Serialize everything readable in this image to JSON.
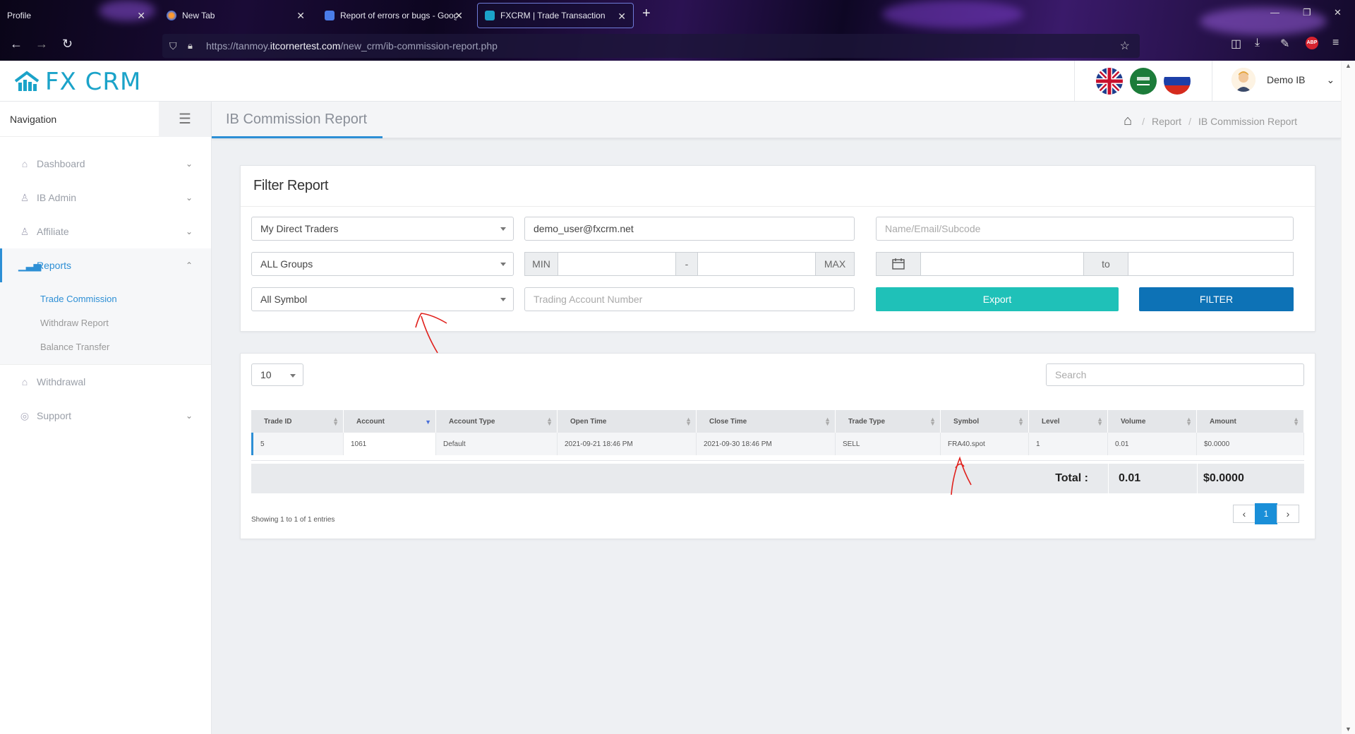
{
  "browser": {
    "tabs": [
      {
        "label": "Profile"
      },
      {
        "label": "New Tab"
      },
      {
        "label": "Report of errors or bugs - Goog"
      },
      {
        "label": "FXCRM | Trade Transaction"
      }
    ],
    "url_prefix": "https://tanmoy.",
    "url_domain": "itcornertest.com",
    "url_path": "/new_crm/ib-commission-report.php"
  },
  "header": {
    "logo_text": "FX CRM",
    "user_name": "Demo IB",
    "flags": [
      "uk-flag",
      "saudi-flag",
      "russia-flag"
    ]
  },
  "sidebar": {
    "title": "Navigation",
    "items": [
      {
        "label": "Dashboard",
        "icon": "home-icon"
      },
      {
        "label": "IB Admin",
        "icon": "user-icon"
      },
      {
        "label": "Affiliate",
        "icon": "users-icon"
      },
      {
        "label": "Reports",
        "icon": "bar-chart-icon"
      },
      {
        "label": "Withdrawal",
        "icon": "bank-icon"
      },
      {
        "label": "Support",
        "icon": "lifebuoy-icon"
      }
    ],
    "reports_sub": [
      "Trade Commission",
      "Withdraw Report",
      "Balance Transfer"
    ]
  },
  "page": {
    "title": "IB Commission Report",
    "breadcrumb": [
      "Report",
      "IB Commission Report"
    ]
  },
  "filter": {
    "title": "Filter Report",
    "traders_select": "My Direct Traders",
    "email_value": "demo_user@fxcrm.net",
    "name_placeholder": "Name/Email/Subcode",
    "groups_select": "ALL Groups",
    "min_label": "MIN",
    "dash_label": "-",
    "max_label": "MAX",
    "to_label": "to",
    "symbol_select": "All Symbol",
    "account_placeholder": "Trading Account Number",
    "export_label": "Export",
    "filter_label": "FILTER"
  },
  "table": {
    "page_size": "10",
    "search_placeholder": "Search",
    "columns": [
      "Trade ID",
      "Account",
      "Account Type",
      "Open Time",
      "Close Time",
      "Trade Type",
      "Symbol",
      "Level",
      "Volume",
      "Amount"
    ],
    "rows": [
      [
        "5",
        "1061",
        "Default",
        "2021-09-21 18:46 PM",
        "2021-09-30 18:46 PM",
        "SELL",
        "FRA40.spot",
        "1",
        "0.01",
        "$0.0000"
      ]
    ],
    "total_label": "Total :",
    "total_volume": "0.01",
    "total_amount": "$0.0000",
    "info": "Showing 1 to 1 of 1 entries",
    "current_page": "1"
  },
  "colors": {
    "accent": "#2d8fd5",
    "export": "#1fc1b8",
    "filter": "#0d72b6",
    "annotation": "#e0201c"
  }
}
